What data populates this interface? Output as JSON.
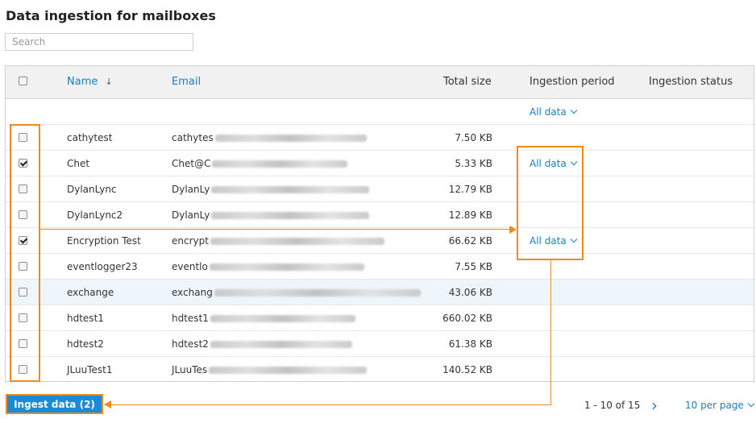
{
  "page": {
    "title": "Data ingestion for mailboxes",
    "search_placeholder": "Search"
  },
  "table": {
    "headers": {
      "name": "Name",
      "sort_indicator": "↓",
      "email": "Email",
      "total_size": "Total size",
      "ingestion_period": "Ingestion period",
      "ingestion_status": "Ingestion status"
    },
    "bulk_period": "All data",
    "rows": [
      {
        "name": "cathytest",
        "email_prefix": "cathytes",
        "size": "7.50 KB",
        "checked": false,
        "period": ""
      },
      {
        "name": "Chet",
        "email_prefix": "Chet@C",
        "size": "5.33 KB",
        "checked": true,
        "period": "All data"
      },
      {
        "name": "DylanLync",
        "email_prefix": "DylanLy",
        "size": "12.79 KB",
        "checked": false,
        "period": ""
      },
      {
        "name": "DylanLync2",
        "email_prefix": "DylanLy",
        "size": "12.89 KB",
        "checked": false,
        "period": ""
      },
      {
        "name": "Encryption Test",
        "email_prefix": "encrypt",
        "size": "66.62 KB",
        "checked": true,
        "period": "All data"
      },
      {
        "name": "eventlogger23",
        "email_prefix": "eventlo",
        "size": "7.55 KB",
        "checked": false,
        "period": ""
      },
      {
        "name": "exchange",
        "email_prefix": "exchang",
        "size": "43.06 KB",
        "checked": false,
        "period": ""
      },
      {
        "name": "hdtest1",
        "email_prefix": "hdtest1",
        "size": "660.02 KB",
        "checked": false,
        "period": ""
      },
      {
        "name": "hdtest2",
        "email_prefix": "hdtest2",
        "size": "61.38 KB",
        "checked": false,
        "period": ""
      },
      {
        "name": "JLuuTest1",
        "email_prefix": "JLuuTes",
        "size": "140.52 KB",
        "checked": false,
        "period": ""
      }
    ]
  },
  "footer": {
    "ingest_button": "Ingest data (2)",
    "range": "1 - 10 of 15",
    "next": "›",
    "per_page": "10 per page"
  },
  "colors": {
    "accent": "#1a7fc1",
    "button": "#1a8bd6",
    "highlight": "#f08a1d"
  }
}
